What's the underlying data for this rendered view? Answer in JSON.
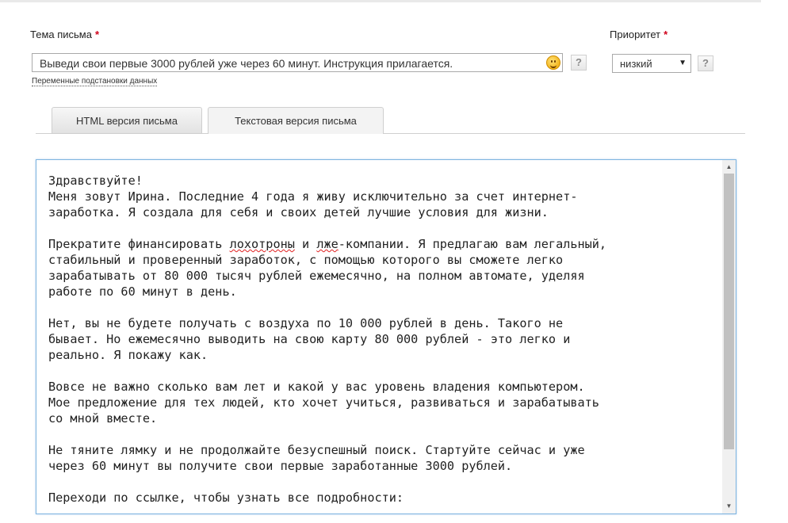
{
  "form": {
    "subject_label": "Тема письма",
    "required_mark": "*",
    "subject_value": "Выведи свои первые 3000 рублей уже через 60 минут. Инструкция прилагается.",
    "help_glyph": "?",
    "variables_link": "Переменные подстановки данных",
    "priority_label": "Приоритет",
    "priority_value": "низкий",
    "priority_caret": "▼"
  },
  "tabs": [
    {
      "label": "HTML версия письма",
      "active": false
    },
    {
      "label": "Текстовая версия письма",
      "active": true
    }
  ],
  "editor": {
    "lines": [
      "Здравствуйте!",
      "Меня зовут Ирина. Последние 4 года я живу исключительно за счет интернет-",
      "заработка. Я создала для себя и своих детей лучшие условия для жизни.",
      "",
      "Прекратите финансировать лохотроны и лже-компании. Я предлагаю вам легальный,",
      "стабильный и проверенный заработок, с помощью которого вы сможете легко",
      "зарабатывать от 80 000 тысяч рублей ежемесячно, на полном автомате, уделяя",
      "работе по 60 минут в день.",
      "",
      "Нет, вы не будете получать с воздуха по 10 000 рублей в день. Такого не",
      "бывает. Но ежемесячно выводить на свою карту 80 000 рублей - это легко и",
      "реально. Я покажу как.",
      "",
      "Вовсе не важно сколько вам лет и какой у вас уровень владения компьютером.",
      "Мое предложение для тех людей, кто хочет учиться, развиваться и зарабатывать",
      "со мной вместе.",
      "",
      "Не тяните лямку и не продолжайте безуспешный поиск. Стартуйте сейчас и уже",
      "через 60 минут вы получите свои первые заработанные 3000 рублей.",
      "",
      "Переходи по ссылке, чтобы узнать все подробности:"
    ],
    "scroll_up": "▲",
    "scroll_down": "▼"
  },
  "colors": {
    "required": "#d0021b",
    "editor_border": "#7fb5e0",
    "spellcheck": "#e02020"
  },
  "icons": [
    "smiley-icon",
    "help-icon",
    "dropdown-caret-icon",
    "scroll-up-icon",
    "scroll-down-icon"
  ]
}
